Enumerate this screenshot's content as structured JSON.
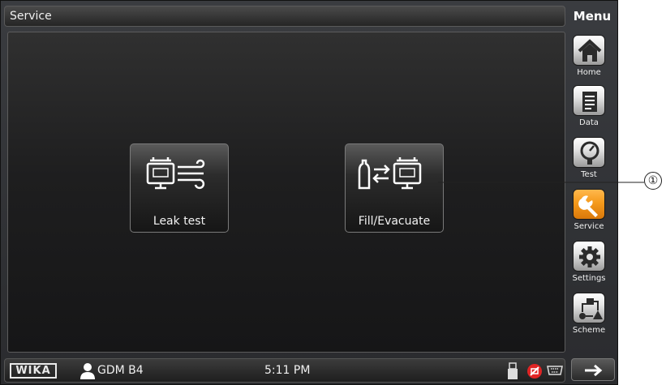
{
  "title_bar": {
    "title": "Service"
  },
  "menu": {
    "title": "Menu",
    "items": [
      {
        "label": "Home",
        "icon": "home-icon"
      },
      {
        "label": "Data",
        "icon": "document-icon"
      },
      {
        "label": "Test",
        "icon": "gauge-icon"
      },
      {
        "label": "Service",
        "icon": "wrench-icon",
        "active": true
      },
      {
        "label": "Settings",
        "icon": "gear-icon"
      },
      {
        "label": "Scheme",
        "icon": "scheme-icon"
      }
    ]
  },
  "main": {
    "tiles": [
      {
        "label": "Leak test",
        "icon": "leak-test-icon"
      },
      {
        "label": "Fill/Evacuate",
        "icon": "fill-evacuate-icon"
      }
    ]
  },
  "status_bar": {
    "logo": "WIKA",
    "user": "GDM B4",
    "time": "5:11 PM",
    "icons": [
      "usb-icon",
      "error-icon",
      "serial-port-icon"
    ]
  },
  "callout": {
    "number": "①"
  },
  "colors": {
    "accent": "#f59a1c",
    "background": "#1e1e1f",
    "text": "#f0f0f0"
  }
}
